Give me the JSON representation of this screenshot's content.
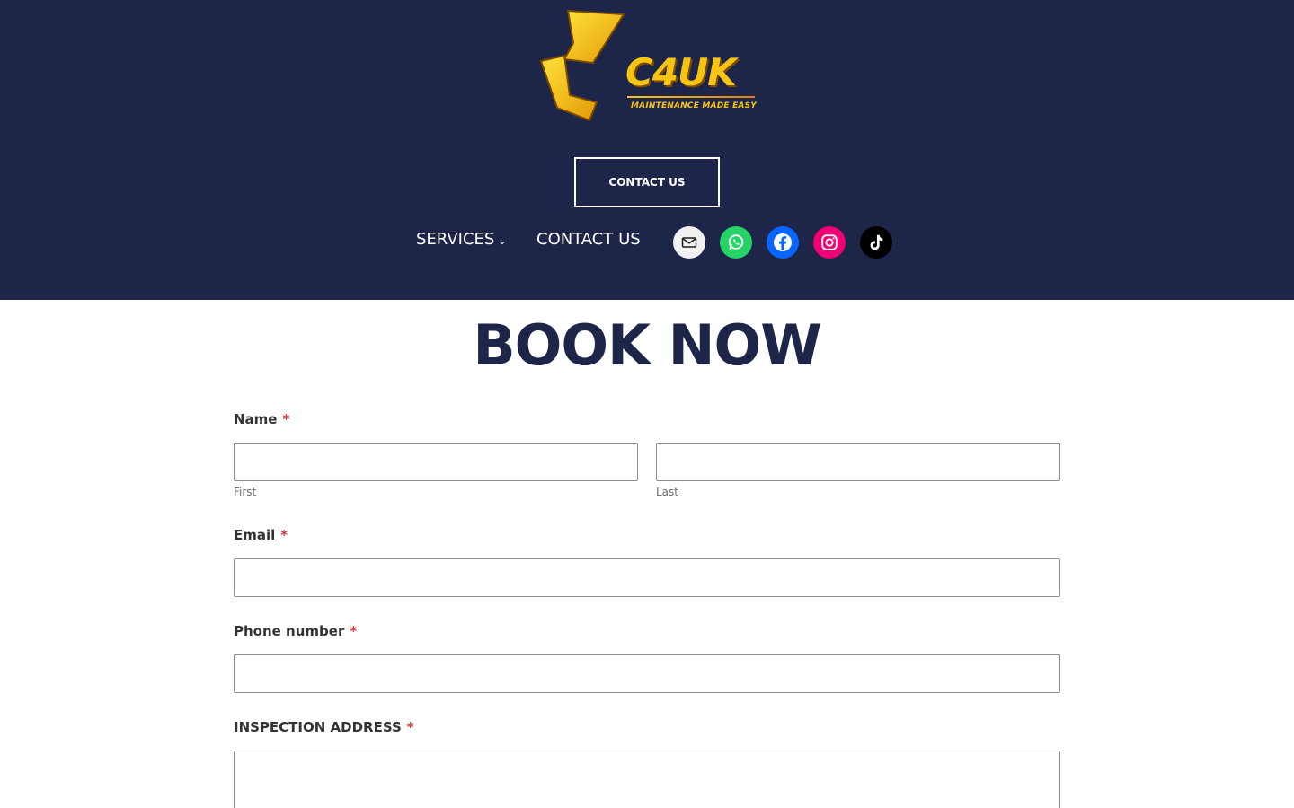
{
  "brand": {
    "name": "C4UK",
    "tagline": "MAINTENANCE MADE EASY",
    "accent": "#f6c514",
    "header_bg": "#1d2548"
  },
  "header": {
    "cta_label": "CONTACT US"
  },
  "nav": {
    "items": [
      {
        "label": "SERVICES",
        "has_dropdown": true
      },
      {
        "label": "CONTACT US",
        "has_dropdown": false
      }
    ]
  },
  "social": [
    {
      "name": "mail-icon",
      "color": "#f0f0f0"
    },
    {
      "name": "whatsapp-icon",
      "color": "#25d366"
    },
    {
      "name": "facebook-icon",
      "color": "#0866ff"
    },
    {
      "name": "instagram-icon",
      "color": "#f00075"
    },
    {
      "name": "tiktok-icon",
      "color": "#000000"
    }
  ],
  "page": {
    "title": "BOOK NOW"
  },
  "form": {
    "required_mark": "*",
    "name": {
      "label": "Name",
      "first_sublabel": "First",
      "last_sublabel": "Last",
      "first_value": "",
      "last_value": ""
    },
    "email": {
      "label": "Email",
      "value": ""
    },
    "phone": {
      "label": "Phone number",
      "value": ""
    },
    "address": {
      "label": "INSPECTION ADDRESS",
      "value": ""
    }
  }
}
